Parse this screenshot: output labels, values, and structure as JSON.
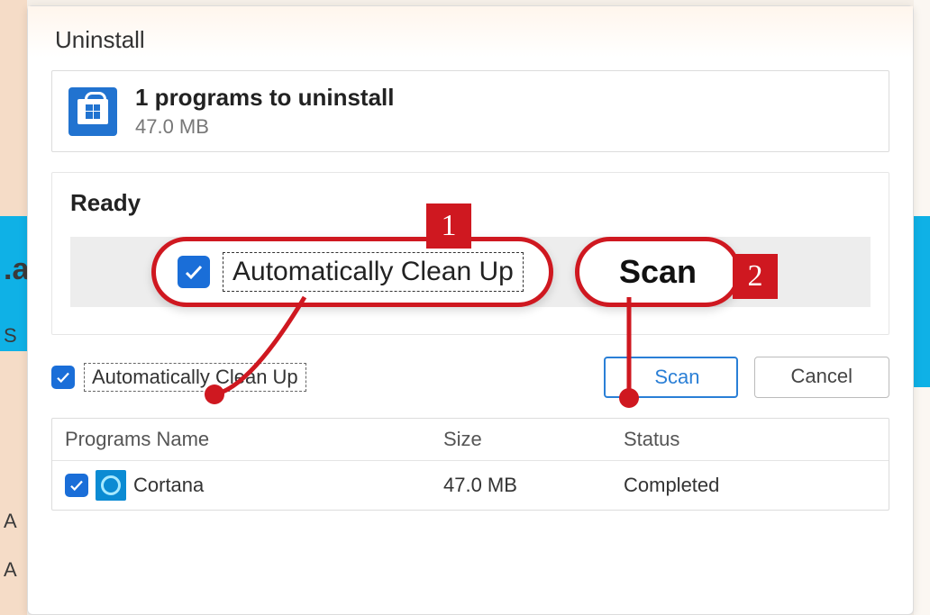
{
  "dialog": {
    "title": "Uninstall",
    "summary": {
      "heading": "1 programs to uninstall",
      "size": "47.0 MB"
    },
    "ready_label": "Ready",
    "auto_clean_label_zoom": "Automatically Clean Up",
    "scan_label_zoom": "Scan",
    "auto_clean_label": "Automatically Clean Up",
    "auto_clean_checked": true,
    "buttons": {
      "scan": "Scan",
      "cancel": "Cancel"
    }
  },
  "annotations": {
    "marker1": "1",
    "marker2": "2"
  },
  "table": {
    "headers": {
      "name": "Programs Name",
      "size": "Size",
      "status": "Status"
    },
    "rows": [
      {
        "checked": true,
        "name": "Cortana",
        "size": "47.0 MB",
        "status": "Completed"
      }
    ]
  },
  "bg_chars": {
    "a1": ".a",
    "s": "S",
    "A1": "A",
    "A2": "A"
  }
}
